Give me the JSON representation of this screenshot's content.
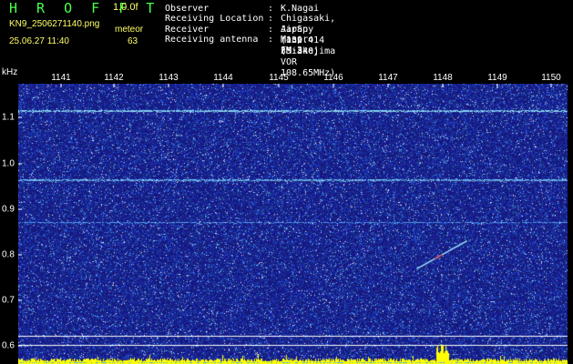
{
  "header": {
    "logo": "H R O F F T",
    "version": "1.0.0f",
    "filename": "KN9_2506271140.png",
    "mode_label": "meteor",
    "datetime": "25.06.27 11:40",
    "count": "63"
  },
  "metadata": [
    {
      "key": "Observer",
      "value": "K.Nagai"
    },
    {
      "key": "Receiving Location",
      "value": "Chigasaki, Japan (139.414 35.340)"
    },
    {
      "key": "Receiver",
      "value": "AirSpy mini (Miakejima VOR 108.65MHz)"
    },
    {
      "key": "Receiving antenna",
      "value": "Maspro FM-3"
    }
  ],
  "axis": {
    "unit": "kHz",
    "x_ticks": [
      "1141",
      "1142",
      "1143",
      "1144",
      "1145",
      "1146",
      "1147",
      "1148",
      "1149",
      "1150"
    ],
    "y_ticks": [
      "1.1",
      "1.0",
      "0.9",
      "0.8",
      "0.7",
      "0.6"
    ]
  },
  "colors": {
    "logo": "#4cff4c",
    "header_text": "#ffff66",
    "meta_text": "#ffffff",
    "background": "#000000",
    "spectrogram_base": "#1a1a8c",
    "power_bar": "#ffff00"
  }
}
